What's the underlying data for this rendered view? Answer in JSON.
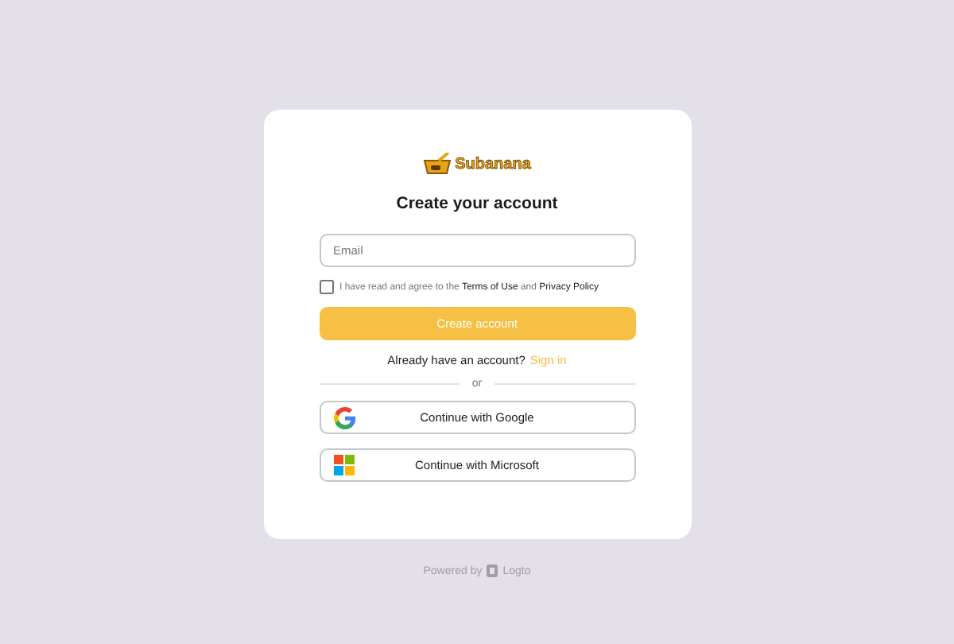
{
  "brand": {
    "name": "Subanana"
  },
  "title": "Create your account",
  "email": {
    "placeholder": "Email"
  },
  "agreement": {
    "checked": false,
    "prefix": "I have read and agree to the",
    "terms": "Terms of Use",
    "middle": "and",
    "privacy": "Privacy Policy"
  },
  "submit": "Create account",
  "signin": {
    "prompt": "Already have an account?",
    "link": "Sign in"
  },
  "divider": "or",
  "social": [
    {
      "kind": "google",
      "label": "Continue with Google"
    },
    {
      "kind": "microsoft",
      "label": "Continue with Microsoft"
    }
  ],
  "footer": {
    "prefix": "Powered by",
    "brand": "Logto"
  }
}
